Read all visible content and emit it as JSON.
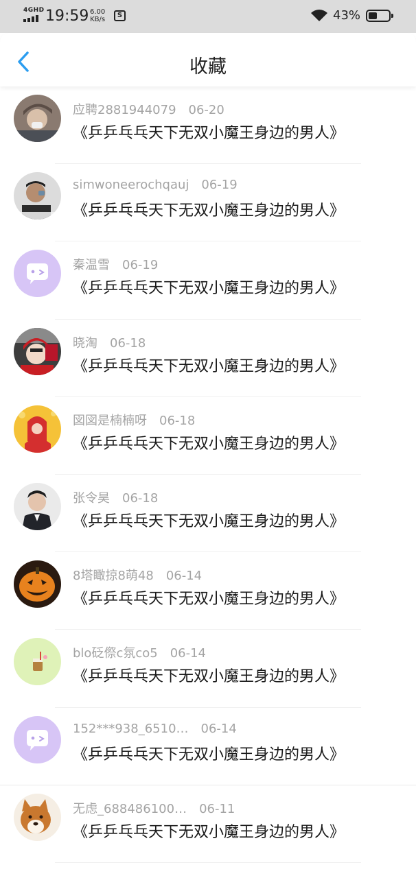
{
  "status_bar": {
    "network": "4GHD",
    "time": "19:59",
    "speed_value": "6.00",
    "speed_unit": "KB/s",
    "battery_percent": "43%",
    "battery_level": 0.43
  },
  "nav": {
    "title": "收藏",
    "back_icon": "chevron-left-icon",
    "accent_color": "#2b9df0"
  },
  "favorites": [
    {
      "user": "应聘2881944079",
      "date": "06-20",
      "title": "《乒乒乓乓天下无双小魔王身边的男人》",
      "avatar": "photo-woman-cap"
    },
    {
      "user": "simwoneerochqauj",
      "date": "06-19",
      "title": "《乒乒乓乓天下无双小魔王身边的男人》",
      "avatar": "photo-man-mic"
    },
    {
      "user": "秦温雪",
      "date": "06-19",
      "title": "《乒乒乓乓天下无双小魔王身边的男人》",
      "avatar": "default-purple-chat"
    },
    {
      "user": "晓淘",
      "date": "06-18",
      "title": "《乒乒乓乓天下无双小魔王身边的男人》",
      "avatar": "photo-helmet"
    },
    {
      "user": "図図是楠楠呀",
      "date": "06-18",
      "title": "《乒乒乓乓天下无双小魔王身边的男人》",
      "avatar": "photo-yellow-red"
    },
    {
      "user": "张令昊",
      "date": "06-18",
      "title": "《乒乒乓乓天下无双小魔王身边的男人》",
      "avatar": "photo-man-suit"
    },
    {
      "user": "8塔瞰掠8萌48",
      "date": "06-14",
      "title": "《乒乒乓乓天下无双小魔王身边的男人》",
      "avatar": "photo-pumpkin"
    },
    {
      "user": "blo砭傺c氛co5",
      "date": "06-14",
      "title": "《乒乒乓乓天下无双小魔王身边的男人》",
      "avatar": "photo-green-drink"
    },
    {
      "user": "152***938_6510…",
      "date": "06-14",
      "title": "《乒乒乓乓天下无双小魔王身边的男人》",
      "avatar": "default-purple-chat"
    },
    {
      "user": "无虑_688486100…",
      "date": "06-11",
      "title": "《乒乒乓乓天下无双小魔王身边的男人》",
      "avatar": "photo-shiba-dog"
    }
  ]
}
